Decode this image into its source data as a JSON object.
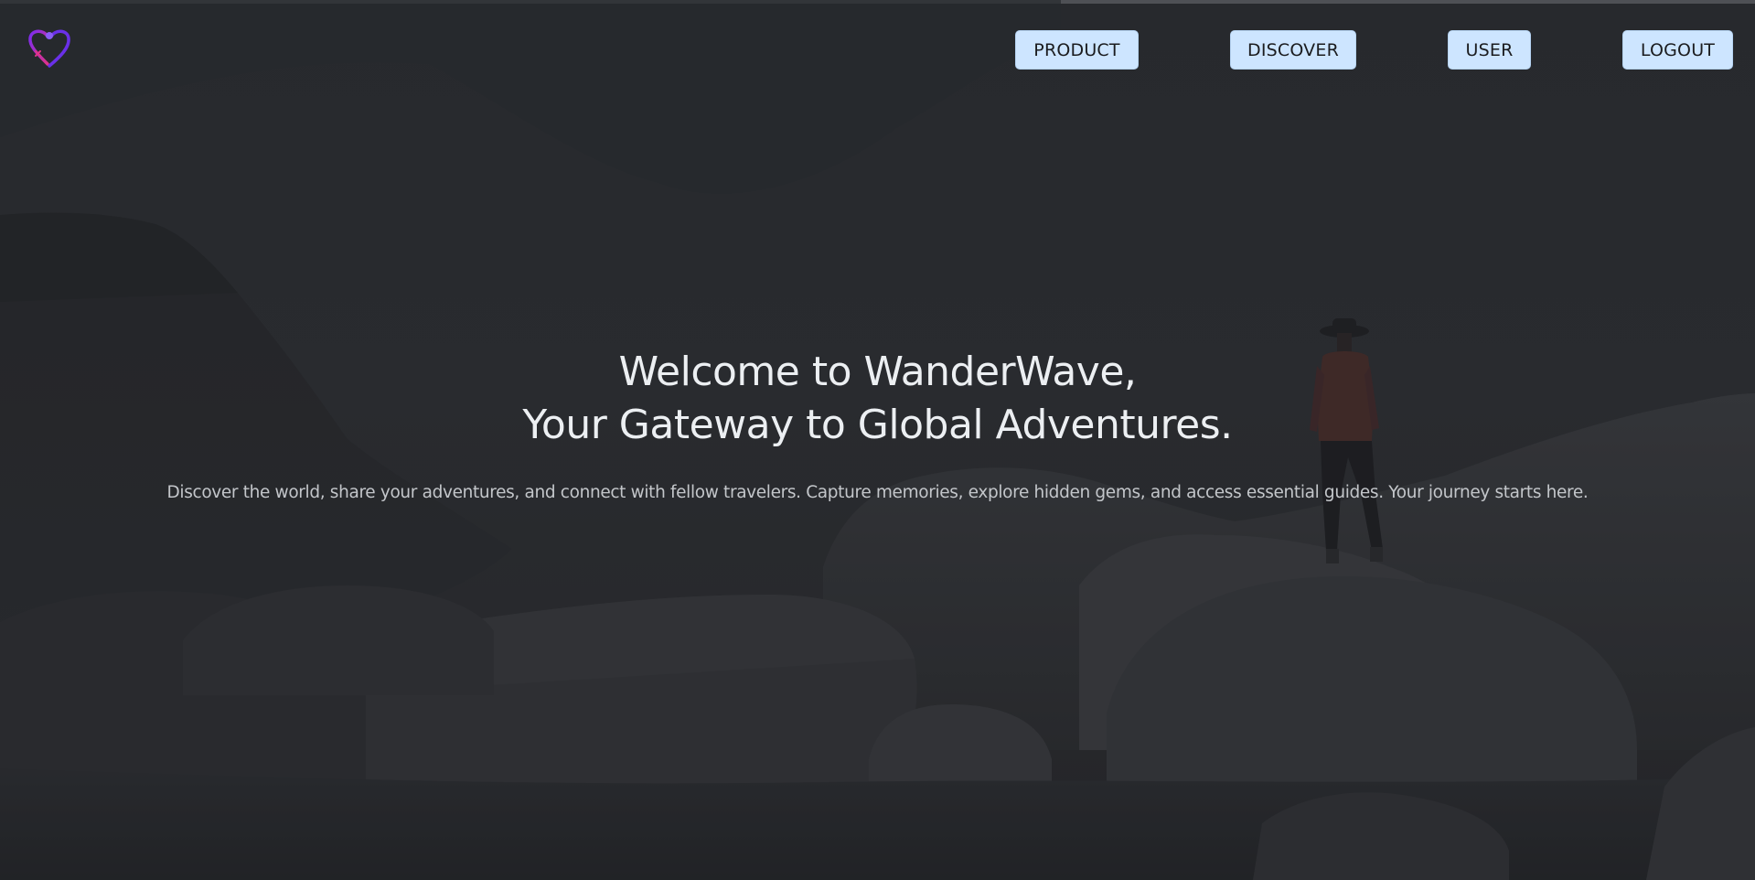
{
  "brand": {
    "logo_icon": "heart-map-pin-icon",
    "colors": {
      "logo_gradient_start": "#7a2cf0",
      "logo_gradient_end": "#e0338b",
      "nav_button_bg": "#cde5ff",
      "nav_button_text": "#1b1c1f",
      "background": "#2b2d31"
    }
  },
  "nav": {
    "items": [
      {
        "label": "PRODUCT"
      },
      {
        "label": "DISCOVER"
      },
      {
        "label": "USER"
      },
      {
        "label": "LOGOUT"
      }
    ]
  },
  "hero": {
    "title_line1": "Welcome to WanderWave,",
    "title_line2": "Your Gateway to Global Adventures.",
    "subtitle": "Discover the world, share your adventures, and connect with fellow travelers. Capture memories, explore hidden gems, and access essential guides. Your journey starts here."
  }
}
